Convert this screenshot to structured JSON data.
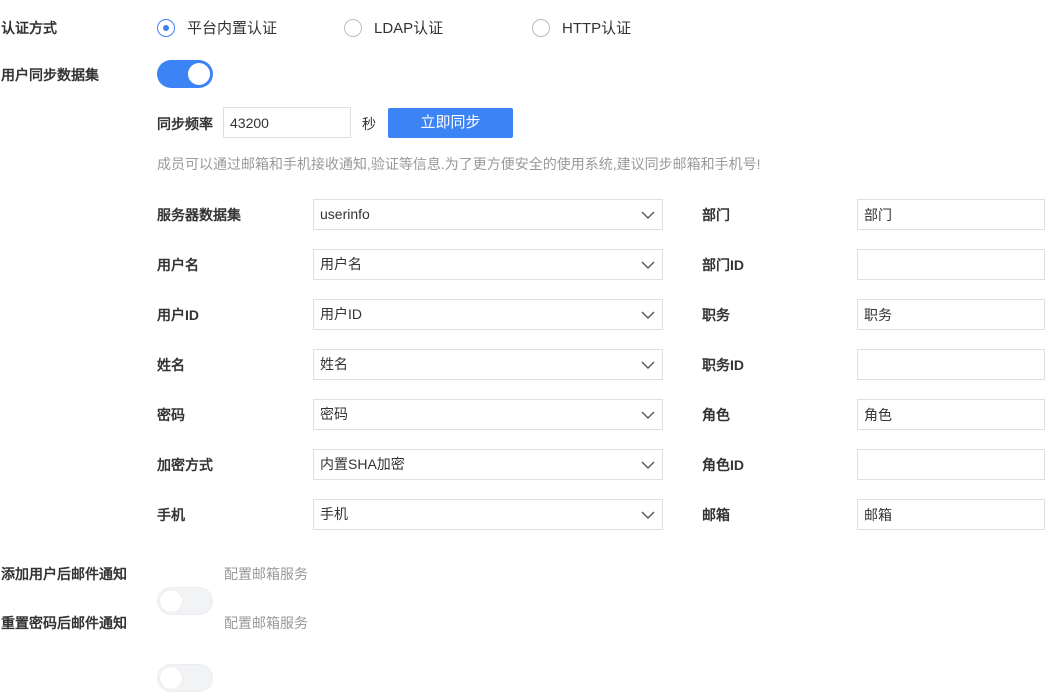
{
  "auth": {
    "label": "认证方式",
    "options": [
      {
        "label": "平台内置认证",
        "checked": true
      },
      {
        "label": "LDAP认证",
        "checked": false
      },
      {
        "label": "HTTP认证",
        "checked": false
      }
    ]
  },
  "sync": {
    "label": "用户同步数据集",
    "enabled": true,
    "frequency_label": "同步频率",
    "frequency_value": "43200",
    "frequency_unit": "秒",
    "sync_now_label": "立即同步",
    "hint": "成员可以通过邮箱和手机接收通知,验证等信息.为了更方便安全的使用系统,建议同步邮箱和手机号!"
  },
  "left_fields": [
    {
      "label": "服务器数据集",
      "value": "userinfo"
    },
    {
      "label": "用户名",
      "value": "用户名"
    },
    {
      "label": "用户ID",
      "value": "用户ID"
    },
    {
      "label": "姓名",
      "value": "姓名"
    },
    {
      "label": "密码",
      "value": "密码"
    },
    {
      "label": "加密方式",
      "value": "内置SHA加密"
    },
    {
      "label": "手机",
      "value": "手机"
    }
  ],
  "right_fields": [
    {
      "label": "部门",
      "value": "部门"
    },
    {
      "label": "部门ID",
      "value": ""
    },
    {
      "label": "职务",
      "value": "职务"
    },
    {
      "label": "职务ID",
      "value": ""
    },
    {
      "label": "角色",
      "value": "角色"
    },
    {
      "label": "角色ID",
      "value": ""
    },
    {
      "label": "邮箱",
      "value": "邮箱"
    }
  ],
  "notify_add": {
    "label": "添加用户后邮件通知",
    "enabled": false,
    "config_label": "配置邮箱服务"
  },
  "notify_reset": {
    "label": "重置密码后邮件通知",
    "enabled": false,
    "config_label": "配置邮箱服务"
  },
  "colors": {
    "accent": "#3c83f6",
    "border": "#dcdfe6",
    "muted_text": "#999999"
  }
}
